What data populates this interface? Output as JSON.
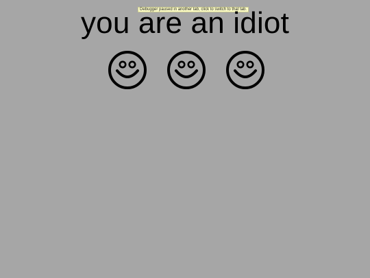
{
  "debugger_banner": {
    "text": "Debugger paused in another tab, click to switch to that tab."
  },
  "headline": {
    "text": "you are an idiot"
  },
  "faces": [
    {
      "icon": "smiley-face-icon"
    },
    {
      "icon": "smiley-face-icon"
    },
    {
      "icon": "smiley-face-icon"
    }
  ],
  "colors": {
    "background": "#a6a6a6",
    "text": "#000000",
    "banner_background": "#ffffc8"
  }
}
